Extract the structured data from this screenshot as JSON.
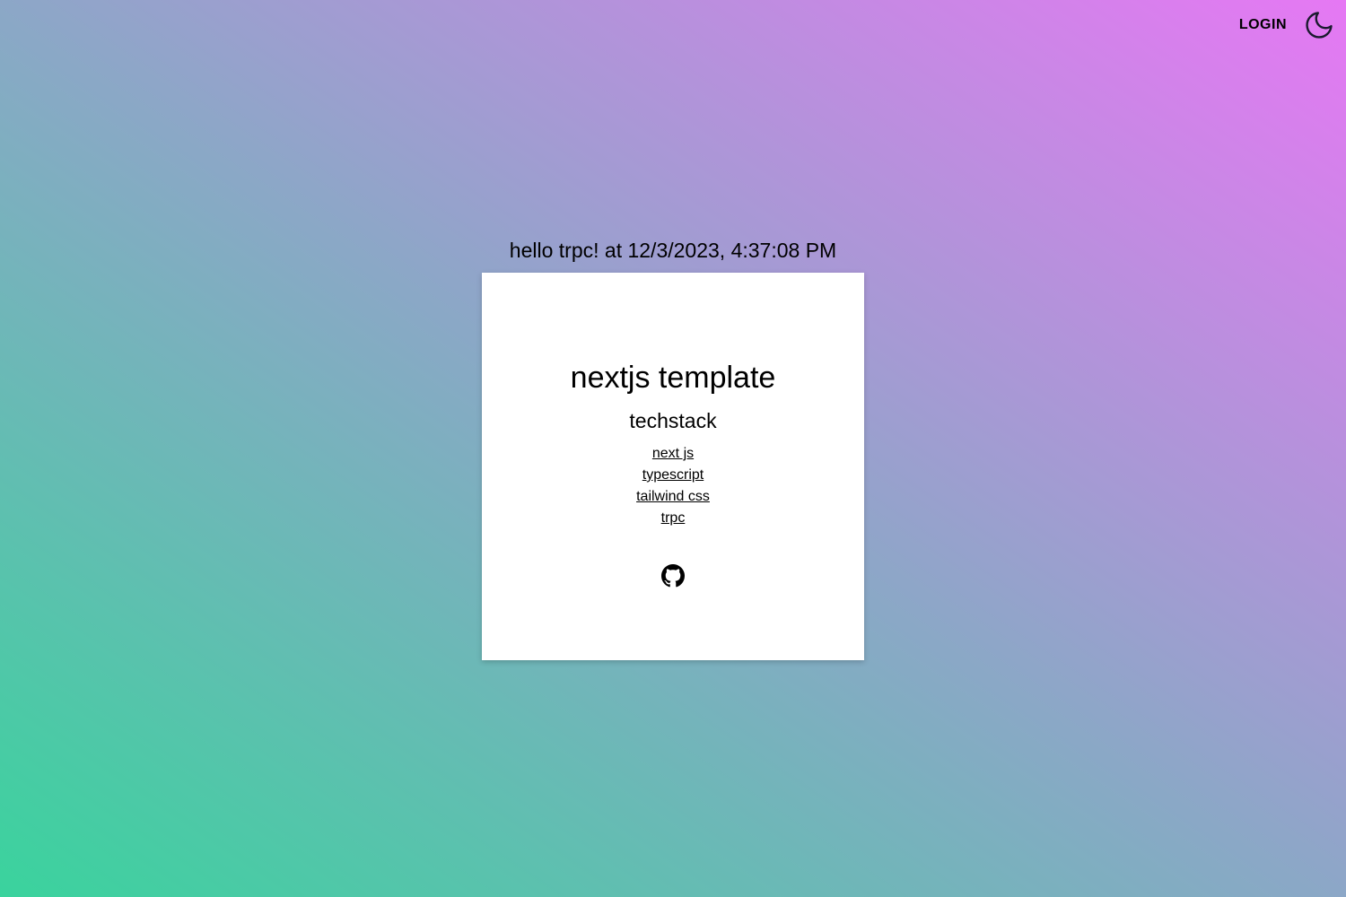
{
  "header": {
    "login_label": "LOGIN",
    "theme_icon": "moon-icon"
  },
  "main": {
    "greeting": "hello trpc! at 12/3/2023, 4:37:08 PM",
    "card": {
      "title": "nextjs template",
      "subtitle": "techstack",
      "links": [
        {
          "label": "next js"
        },
        {
          "label": "typescript"
        },
        {
          "label": "tailwind css"
        },
        {
          "label": "trpc"
        }
      ],
      "github_icon": "github-icon"
    }
  },
  "colors": {
    "gradient_bottom_left": "#3ad39d",
    "gradient_middle": "#8ca7c7",
    "gradient_top_right": "#e678f4",
    "card_background": "#ffffff",
    "text": "#000000"
  }
}
